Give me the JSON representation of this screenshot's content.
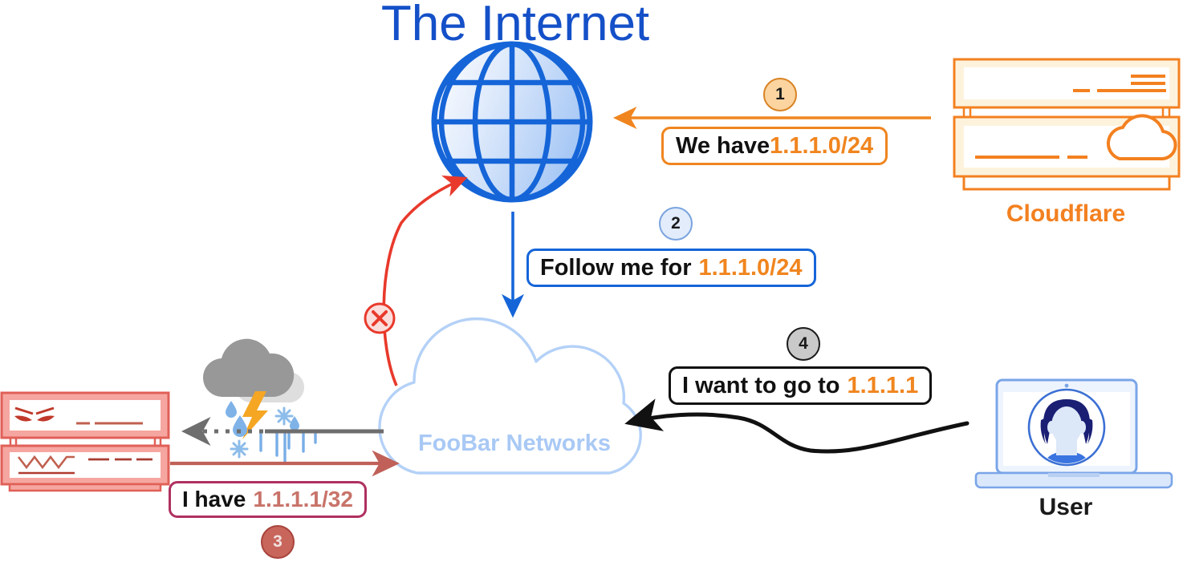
{
  "diagram": {
    "title": "The Internet",
    "title_color": "#1450c8",
    "background": "#ffffff"
  },
  "nodes": {
    "internet": {
      "label": "The Internet",
      "icon": "globe-icon",
      "color": "#1565d8"
    },
    "cloudflare": {
      "label": "Cloudflare",
      "icon": "router-icon",
      "color": "#f38020",
      "sub_icon": "cloud-icon"
    },
    "foobar": {
      "label": "FooBar Networks",
      "icon": "cloud-icon",
      "color": "#a9c9f5"
    },
    "user": {
      "label": "User",
      "icon": "laptop-icon",
      "color": "#1a1a1a",
      "avatar": "person-avatar-icon"
    },
    "attacker": {
      "label": "",
      "icon": "evil-router-icon",
      "color": "#e98680",
      "face": "angry-face-icon"
    },
    "storm": {
      "icon": "storm-cloud-icon",
      "color": "#9a9a9a",
      "bolt_color": "#f5a623",
      "rain_color": "#7fb3e8"
    }
  },
  "steps": [
    {
      "number": "1",
      "text": "We have ",
      "address": "1.1.1.0/24",
      "border_color": "#f0851f",
      "address_color": "#f0851f",
      "badge_fill": "#fbd4a0",
      "badge_border": "#d98324",
      "arrow": "cloudflare-to-internet-arrow"
    },
    {
      "number": "2",
      "text": "Follow me for",
      "address": "1.1.1.0/24",
      "border_color": "#1565d8",
      "address_color": "#f0851f",
      "badge_fill": "#e2ecfb",
      "badge_border": "#7aa4de",
      "arrow": "internet-to-foobar-arrow"
    },
    {
      "number": "3",
      "text": "I have",
      "address": "1.1.1.1/32",
      "border_color": "#b03060",
      "address_color": "#c8736a",
      "badge_fill": "#c8665c",
      "badge_border": "#a8443c",
      "arrow": "attacker-to-foobar-arrow"
    },
    {
      "number": "4",
      "text": "I want to go to",
      "address": "1.1.1.1",
      "border_color": "#111111",
      "address_color": "#f0851f",
      "badge_fill": "#c9c9c9",
      "badge_border": "#1a1a1a",
      "arrow": "user-to-foobar-arrow"
    }
  ],
  "markers": {
    "blocked": {
      "icon": "x-circle-icon",
      "color": "#e8392b",
      "fill": "#fbdedb",
      "meaning": "blocked-route"
    }
  },
  "arrows": {
    "cloudflare_to_internet": {
      "color": "#f0851f",
      "style": "solid",
      "direction": "left"
    },
    "internet_to_foobar": {
      "color": "#1565d8",
      "style": "solid",
      "direction": "down"
    },
    "foobar_to_internet_blocked": {
      "color": "#e8392b",
      "style": "curved",
      "direction": "up"
    },
    "foobar_to_attacker_degraded": {
      "color": "#6e6e6e",
      "style": "solid-to-dotted",
      "direction": "left"
    },
    "attacker_to_foobar": {
      "color": "#c06058",
      "style": "solid",
      "direction": "right"
    },
    "user_to_foobar": {
      "color": "#111111",
      "style": "s-curve",
      "direction": "left"
    }
  }
}
